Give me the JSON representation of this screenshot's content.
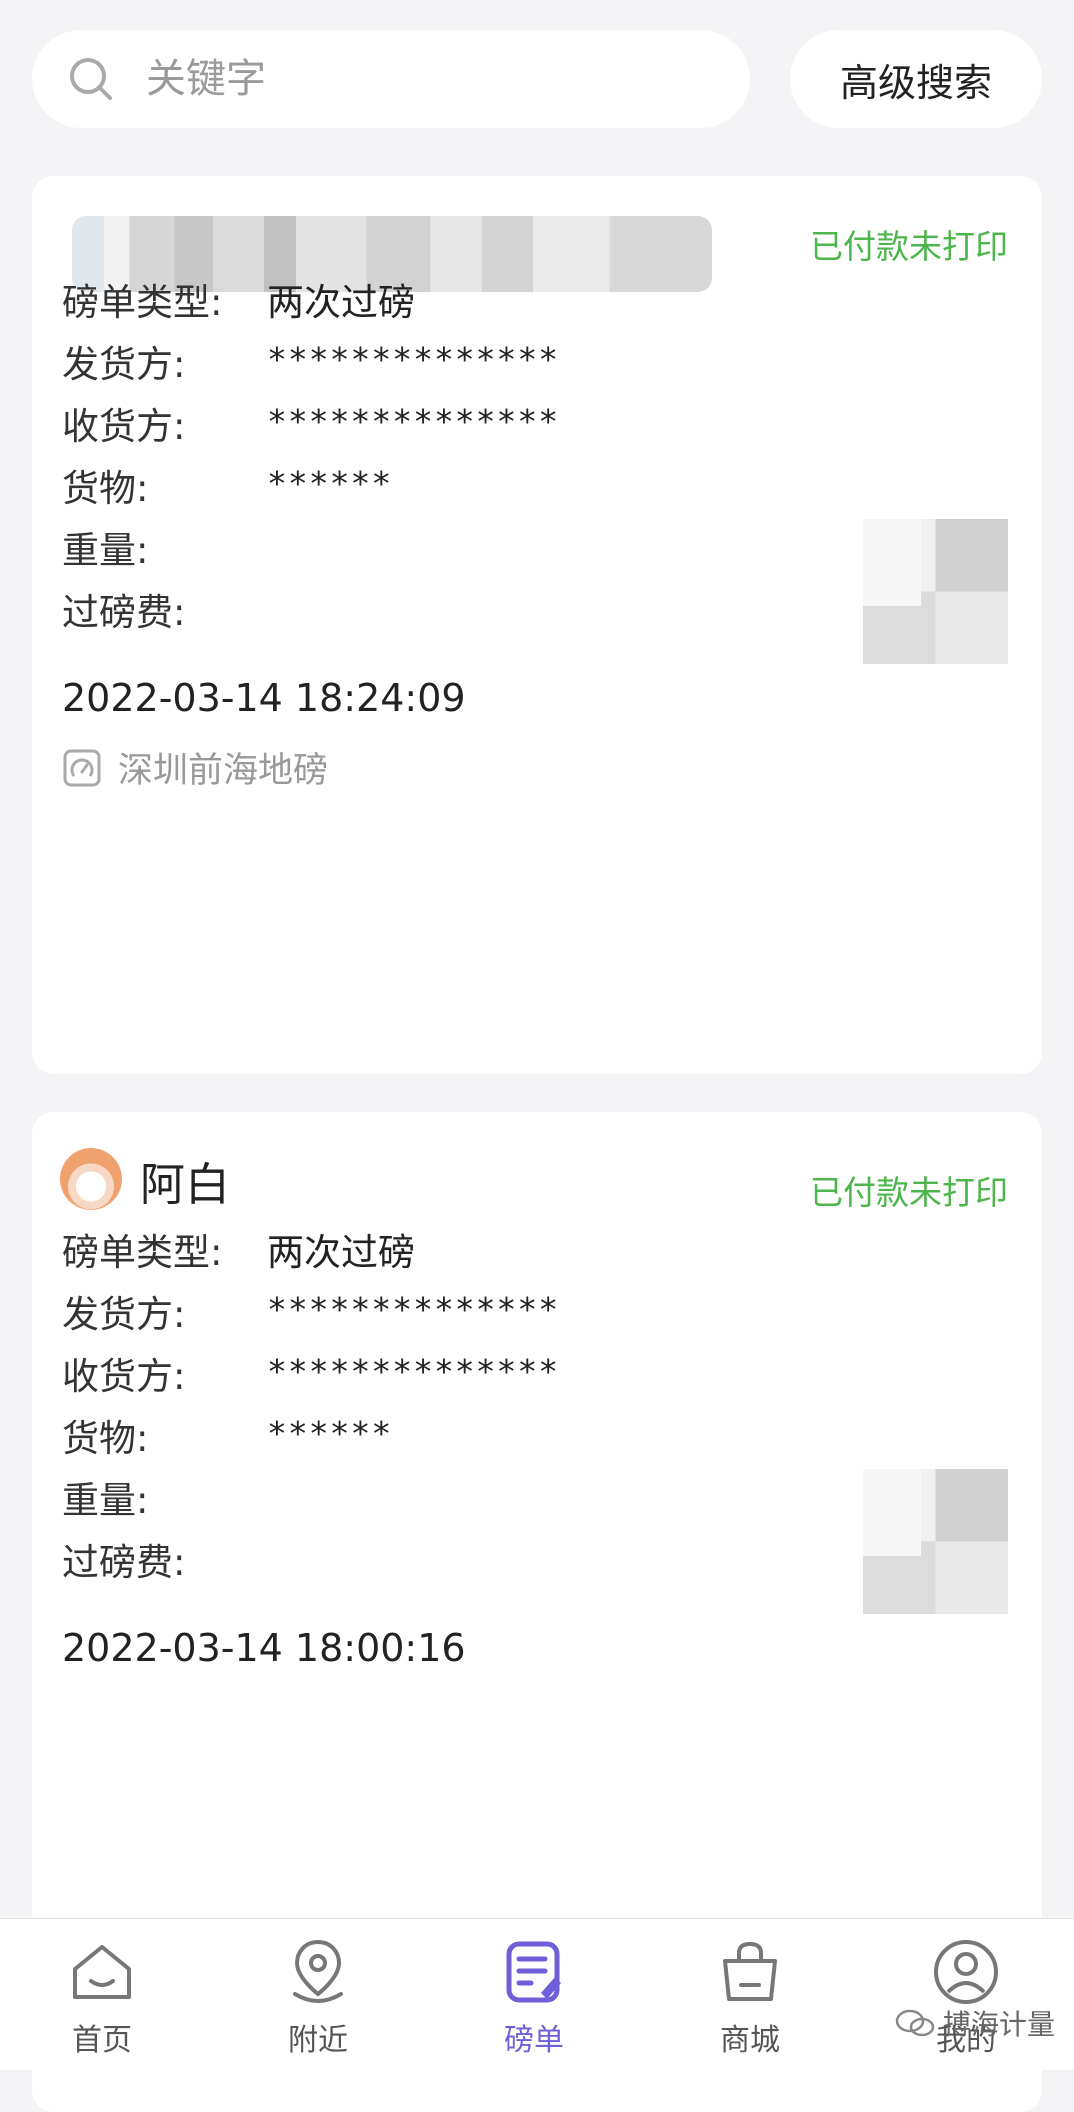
{
  "search": {
    "placeholder": "关键字",
    "advanced_label": "高级搜索"
  },
  "records": [
    {
      "owner_name": "",
      "status": "已付款未打印",
      "fields": {
        "type_label": "磅单类型:",
        "type_value": "两次过磅",
        "sender_label": "发货方:",
        "sender_value": "**************",
        "receiver_label": "收货方:",
        "receiver_value": "**************",
        "goods_label": "货物:",
        "goods_value": "******",
        "weight_label": "重量:",
        "fee_label": "过磅费:"
      },
      "datetime": "2022-03-14 18:24:09",
      "location": "深圳前海地磅"
    },
    {
      "owner_name": "阿白",
      "status": "已付款未打印",
      "fields": {
        "type_label": "磅单类型:",
        "type_value": "两次过磅",
        "sender_label": "发货方:",
        "sender_value": "**************",
        "receiver_label": "收货方:",
        "receiver_value": "**************",
        "goods_label": "货物:",
        "goods_value": "******",
        "weight_label": "重量:",
        "fee_label": "过磅费:"
      },
      "datetime": "2022-03-14 18:00:16"
    }
  ],
  "tabbar": {
    "items": [
      {
        "label": "首页",
        "icon": "home-icon"
      },
      {
        "label": "附近",
        "icon": "location-pin-icon"
      },
      {
        "label": "磅单",
        "icon": "document-edit-icon",
        "active": true
      },
      {
        "label": "商城",
        "icon": "shopping-bag-icon"
      },
      {
        "label": "我的",
        "icon": "user-icon"
      }
    ]
  },
  "watermark": "搏海计量",
  "colors": {
    "accent": "#6f5fd8",
    "status_green": "#4cb54c",
    "background": "#f4f4f6"
  }
}
